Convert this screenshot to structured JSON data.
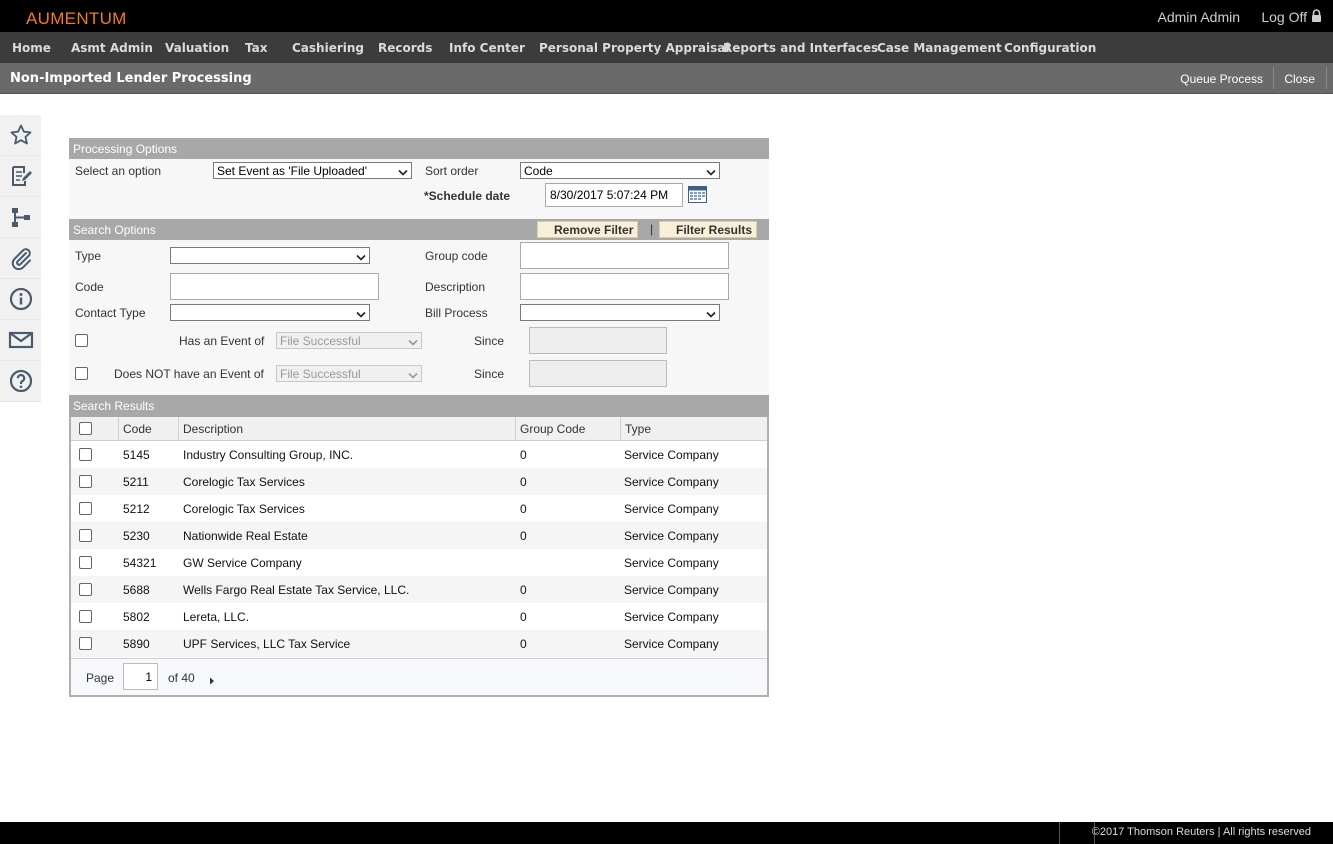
{
  "app": {
    "logo": "AUMENTUM",
    "user": "Admin Admin",
    "logoff": "Log Off"
  },
  "nav": [
    "Home",
    "Asmt Admin",
    "Valuation",
    "Tax",
    "Cashiering",
    "Records",
    "Info Center",
    "Personal Property Appraisal",
    "Reports and Interfaces",
    "Case Management",
    "Configuration"
  ],
  "page": {
    "title": "Non-Imported Lender Processing",
    "queue_process": "Queue Process",
    "close": "Close"
  },
  "sidebar_icons": [
    "star-icon",
    "edit-document-icon",
    "hierarchy-icon",
    "paperclip-icon",
    "info-icon",
    "mail-icon",
    "help-icon"
  ],
  "processing": {
    "header": "Processing Options",
    "select_option_label": "Select an option",
    "select_option_value": "Set Event as 'File Uploaded'",
    "sort_order_label": "Sort order",
    "sort_order_value": "Code",
    "schedule_date_label": "*Schedule date",
    "schedule_date_value": "8/30/2017 5:07:24 PM"
  },
  "search": {
    "header": "Search Options",
    "remove_filter": "Remove Filter",
    "separator": "|",
    "filter_results": "Filter Results",
    "type_label": "Type",
    "type_value": "",
    "group_code_label": "Group code",
    "group_code_value": "",
    "code_label": "Code",
    "code_value": "",
    "description_label": "Description",
    "description_value": "",
    "contact_type_label": "Contact Type",
    "contact_type_value": "",
    "bill_process_label": "Bill Process",
    "bill_process_value": "",
    "has_event_label": "Has an Event of",
    "has_event_value": "File Successful",
    "not_event_label": "Does NOT have an Event of",
    "not_event_value": "File Successful",
    "since_label": "Since",
    "since_value": ""
  },
  "results": {
    "header": "Search Results",
    "columns": [
      "Code",
      "Description",
      "Group Code",
      "Type"
    ],
    "rows": [
      {
        "code": "5145",
        "description": "Industry Consulting Group, INC.",
        "group": "0",
        "type": "Service Company"
      },
      {
        "code": "5211",
        "description": "Corelogic Tax Services",
        "group": "0",
        "type": "Service Company"
      },
      {
        "code": "5212",
        "description": "Corelogic Tax Services",
        "group": "0",
        "type": "Service Company"
      },
      {
        "code": "5230",
        "description": "Nationwide Real Estate",
        "group": "0",
        "type": "Service Company"
      },
      {
        "code": "54321",
        "description": "GW Service Company",
        "group": "",
        "type": "Service Company"
      },
      {
        "code": "5688",
        "description": "Wells Fargo Real Estate Tax Service, LLC.",
        "group": "0",
        "type": "Service Company"
      },
      {
        "code": "5802",
        "description": "Lereta, LLC.",
        "group": "0",
        "type": "Service Company"
      },
      {
        "code": "5890",
        "description": "UPF Services, LLC Tax Service",
        "group": "0",
        "type": "Service Company"
      }
    ],
    "pager": {
      "page_label": "Page",
      "page": "1",
      "of_label": "of 40"
    }
  },
  "footer": {
    "copyright": "©2017 Thomson Reuters | All rights reserved"
  },
  "colors": {
    "accent": "#f47b20",
    "topbar": "#000000",
    "navbar": "#3c3c3c",
    "pagebar": "#6a6a6a",
    "section_header": "#a8a8a8"
  }
}
